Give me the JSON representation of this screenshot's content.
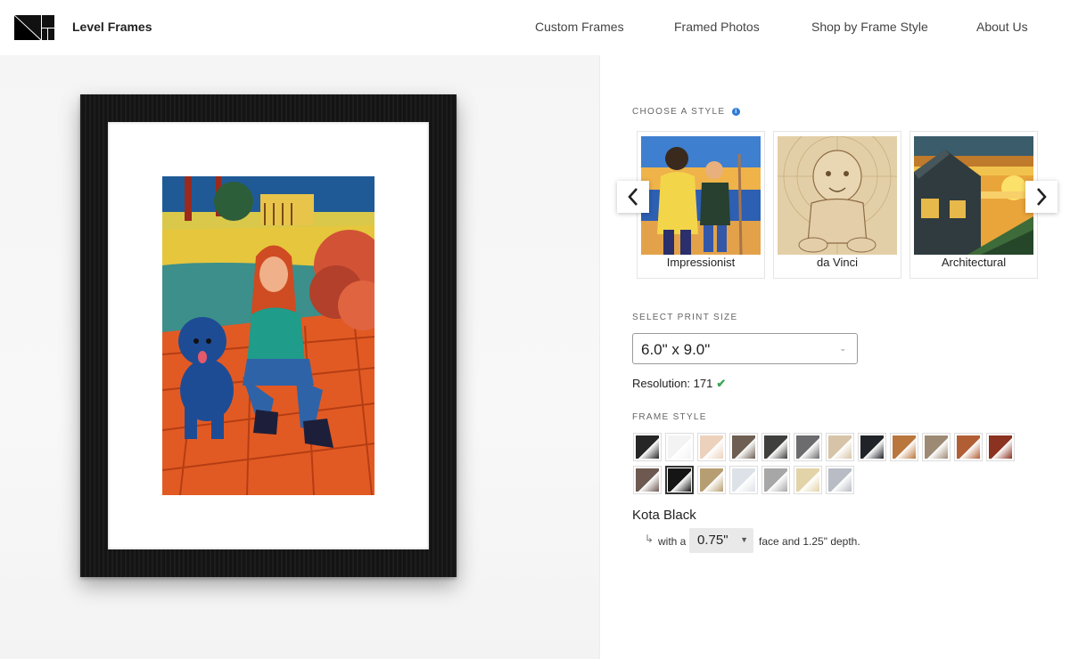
{
  "header": {
    "brand": "Level Frames",
    "nav": [
      "Custom Frames",
      "Framed Photos",
      "Shop by Frame Style",
      "About Us"
    ]
  },
  "style_section": {
    "label": "CHOOSE A STYLE",
    "info_icon": "info-icon",
    "styles": [
      {
        "label": "Impressionist"
      },
      {
        "label": "da Vinci"
      },
      {
        "label": "Architectural"
      }
    ],
    "prev_icon": "chevron-left-icon",
    "next_icon": "chevron-right-icon"
  },
  "print_size": {
    "label": "SELECT PRINT SIZE",
    "value": "6.0\" x 9.0\"",
    "resolution_label": "Resolution: 171"
  },
  "frame_style": {
    "label": "FRAME STYLE",
    "selected_name": "Kota Black",
    "with_text": "with a",
    "face_value": "0.75\"",
    "depth_text": "face and 1.25\" depth.",
    "swatches": [
      {
        "color": "#262626",
        "selected": false
      },
      {
        "color": "#f3f3f3",
        "selected": false
      },
      {
        "color": "#ecd2bd",
        "selected": false
      },
      {
        "color": "#6e5f52",
        "selected": false
      },
      {
        "color": "#3f403d",
        "selected": false
      },
      {
        "color": "#6c6c6e",
        "selected": false
      },
      {
        "color": "#d7c4a8",
        "selected": false
      },
      {
        "color": "#202328",
        "selected": false
      },
      {
        "color": "#b9763d",
        "selected": false
      },
      {
        "color": "#9d8a74",
        "selected": false
      },
      {
        "color": "#b25e35",
        "selected": false
      },
      {
        "color": "#8c3221",
        "selected": false
      },
      {
        "color": "#6d5950",
        "selected": false
      },
      {
        "color": "#151515",
        "selected": true
      },
      {
        "color": "#b79e72",
        "selected": false
      },
      {
        "color": "#dde2e8",
        "selected": false
      },
      {
        "color": "#a7a7a7",
        "selected": false
      },
      {
        "color": "#e3d3a8",
        "selected": false
      },
      {
        "color": "#b8bcc4",
        "selected": false
      }
    ]
  }
}
